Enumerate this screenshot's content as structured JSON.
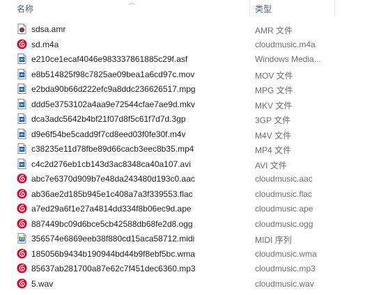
{
  "header": {
    "name_label": "名称",
    "type_label": "类型"
  },
  "files": [
    {
      "name": "sdsa.amr",
      "type": "AMR 文件",
      "icon": "amr"
    },
    {
      "name": "sd.m4a",
      "type": "cloudmusic.m4a",
      "icon": "netease"
    },
    {
      "name": "e210ce1ecaf4046e983337861885c29f.asf",
      "type": "Windows Media...",
      "icon": "media"
    },
    {
      "name": "e8b514825f98c7825ae09bea1a6cd97c.mov",
      "type": "MOV 文件",
      "icon": "video"
    },
    {
      "name": "e2bda90b66d222efc9a8ddc236626517.mpg",
      "type": "MPG 文件",
      "icon": "video"
    },
    {
      "name": "ddd5e3753102a4aa9e72544cfae7ae9d.mkv",
      "type": "MKV 文件",
      "icon": "video"
    },
    {
      "name": "dca3adc5642b4bf21f07d8f5c61f7d7d.3gp",
      "type": "3GP 文件",
      "icon": "video"
    },
    {
      "name": "d9e6f54be5cadd9f7cd8eed03f0fe30f.m4v",
      "type": "M4V 文件",
      "icon": "video"
    },
    {
      "name": "c38235e11d78fbe89d66cacb3eec8b35.mp4",
      "type": "MP4 文件",
      "icon": "video"
    },
    {
      "name": "c4c2d276eb1cb143d3ac8348ca40a107.avi",
      "type": "AVI 文件",
      "icon": "video"
    },
    {
      "name": "abc7e6370d909b7e48da243480d193c0.aac",
      "type": "cloudmusic.aac",
      "icon": "netease"
    },
    {
      "name": "ab36ae2d185b945e1c408a7a3f339553.flac",
      "type": "cloudmusic.flac",
      "icon": "netease"
    },
    {
      "name": "a7ed29a6f1e27a4814dd334f8b06ec9d.ape",
      "type": "cloudmusic.ape",
      "icon": "netease"
    },
    {
      "name": "887449bc09d6bce5cb42588db68fe2d8.ogg",
      "type": "cloudmusic.ogg",
      "icon": "netease"
    },
    {
      "name": "356574e6869eeb38f880cd15aca58712.midi",
      "type": "MIDI 序列",
      "icon": "midi"
    },
    {
      "name": "185056b9434b190944bd44b9f8ebf5bc.wma",
      "type": "cloudmusic.wma",
      "icon": "netease"
    },
    {
      "name": "85637ab281700a87e62c7f451dec6360.mp3",
      "type": "cloudmusic.mp3",
      "icon": "netease"
    },
    {
      "name": "5.wav",
      "type": "cloudmusic.wav",
      "icon": "netease"
    }
  ],
  "colors": {
    "netease_red": "#e60026",
    "video_blue": "#2a6fb8",
    "header_text": "#4c607a",
    "type_text": "#6d6d6d"
  },
  "icons": {
    "amr": "amr-file-icon",
    "netease": "cloudmusic-icon",
    "media": "windows-media-file-icon",
    "video": "video-file-icon",
    "midi": "midi-file-icon"
  }
}
